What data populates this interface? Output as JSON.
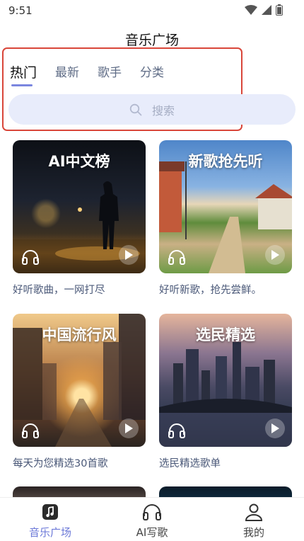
{
  "status_bar": {
    "time": "9:51"
  },
  "page_title": "音乐广场",
  "tabs": [
    {
      "label": "热门",
      "active": true
    },
    {
      "label": "最新",
      "active": false
    },
    {
      "label": "歌手",
      "active": false
    },
    {
      "label": "分类",
      "active": false
    }
  ],
  "search": {
    "placeholder": "搜索"
  },
  "cards": [
    {
      "title": "AI中文榜",
      "desc": "好听歌曲，一网打尽"
    },
    {
      "title": "新歌抢先听",
      "desc": "好听新歌，抢先尝鲜。"
    },
    {
      "title": "中国流行风",
      "desc": "每天为您精选30首歌"
    },
    {
      "title": "选民精选",
      "desc": "选民精选歌单"
    }
  ],
  "bottom_nav": [
    {
      "label": "音乐广场",
      "icon": "music-note-icon",
      "active": true
    },
    {
      "label": "AI写歌",
      "icon": "headphones-icon",
      "active": false
    },
    {
      "label": "我的",
      "icon": "person-icon",
      "active": false
    }
  ],
  "colors": {
    "accent": "#6c79d8",
    "highlight_box": "#d9463a",
    "search_bg": "#e8ecfb"
  }
}
